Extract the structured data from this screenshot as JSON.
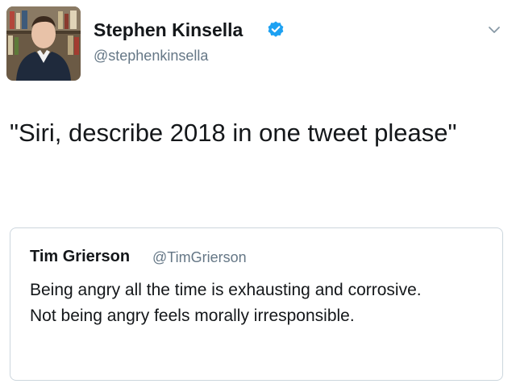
{
  "tweet": {
    "author": {
      "display_name": "Stephen Kinsella",
      "handle": "@stephenkinsella",
      "verified": true
    },
    "text": "\"Siri, describe 2018 in one tweet please\"",
    "menu_icon": "chevron-down-icon",
    "quoted": {
      "display_name": "Tim Grierson",
      "handle": "@TimGrierson",
      "text": "Being angry all the time is exhausting and corrosive. Not being angry feels morally irresponsible."
    }
  },
  "colors": {
    "verified": "#1da1f2",
    "secondary_text": "#657786",
    "border": "#ccd6dd"
  }
}
